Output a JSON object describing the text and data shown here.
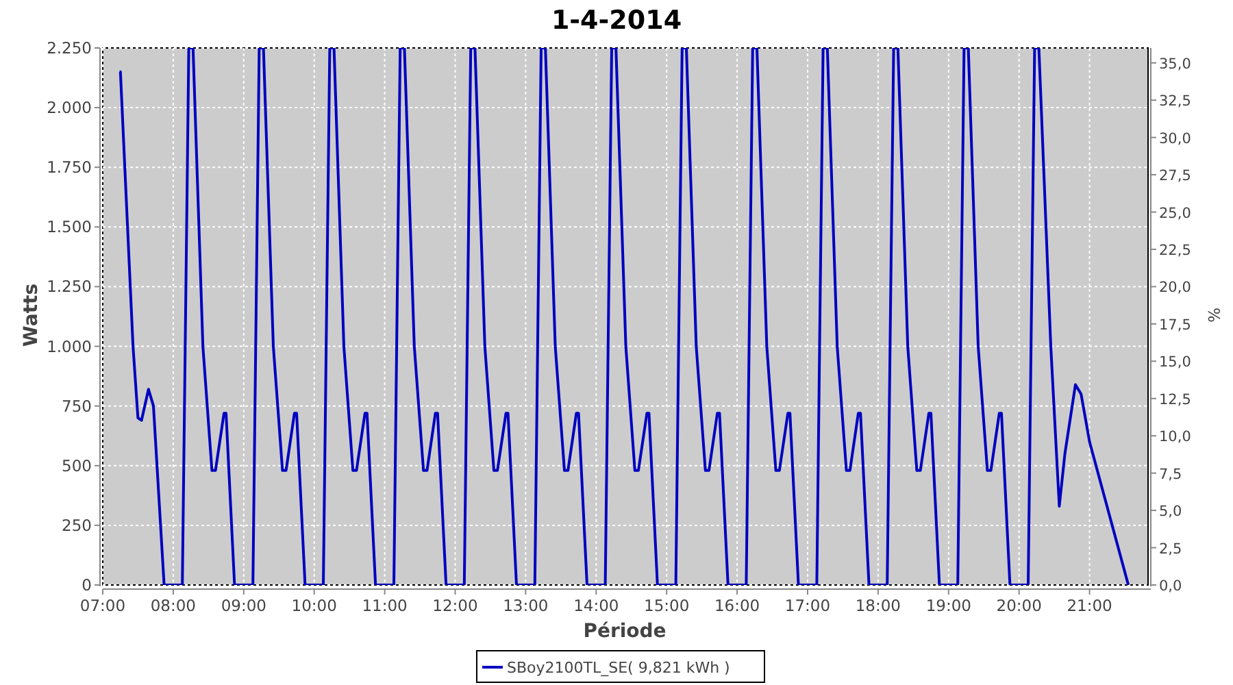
{
  "chart_data": {
    "type": "line",
    "title": "1-4-2014",
    "xlabel": "Période",
    "ylabel": "Watts",
    "y2label": "%",
    "grid": true,
    "xlim": [
      7,
      21.83
    ],
    "ylim": [
      0,
      2250
    ],
    "y2lim": [
      0,
      36
    ],
    "xticks": [
      {
        "value": 7,
        "label": "07:00"
      },
      {
        "value": 8,
        "label": "08:00"
      },
      {
        "value": 9,
        "label": "09:00"
      },
      {
        "value": 10,
        "label": "10:00"
      },
      {
        "value": 11,
        "label": "11:00"
      },
      {
        "value": 12,
        "label": "12:00"
      },
      {
        "value": 13,
        "label": "13:00"
      },
      {
        "value": 14,
        "label": "14:00"
      },
      {
        "value": 15,
        "label": "15:00"
      },
      {
        "value": 16,
        "label": "16:00"
      },
      {
        "value": 17,
        "label": "17:00"
      },
      {
        "value": 18,
        "label": "18:00"
      },
      {
        "value": 19,
        "label": "19:00"
      },
      {
        "value": 20,
        "label": "20:00"
      },
      {
        "value": 21,
        "label": "21:00"
      }
    ],
    "yticks": [
      {
        "value": 0,
        "label": "0"
      },
      {
        "value": 250,
        "label": "250"
      },
      {
        "value": 500,
        "label": "500"
      },
      {
        "value": 750,
        "label": "750"
      },
      {
        "value": 1000,
        "label": "1.000"
      },
      {
        "value": 1250,
        "label": "1.250"
      },
      {
        "value": 1500,
        "label": "1.500"
      },
      {
        "value": 1750,
        "label": "1.750"
      },
      {
        "value": 2000,
        "label": "2.000"
      },
      {
        "value": 2250,
        "label": "2.250"
      }
    ],
    "y2ticks": [
      {
        "value": 0,
        "label": "0,0"
      },
      {
        "value": 2.5,
        "label": "2,5"
      },
      {
        "value": 5,
        "label": "5,0"
      },
      {
        "value": 7.5,
        "label": "7,5"
      },
      {
        "value": 10,
        "label": "10,0"
      },
      {
        "value": 12.5,
        "label": "12,5"
      },
      {
        "value": 15,
        "label": "15,0"
      },
      {
        "value": 17.5,
        "label": "17,5"
      },
      {
        "value": 20,
        "label": "20,0"
      },
      {
        "value": 22.5,
        "label": "22,5"
      },
      {
        "value": 25,
        "label": "25,0"
      },
      {
        "value": 27.5,
        "label": "27,5"
      },
      {
        "value": 30,
        "label": "30,0"
      },
      {
        "value": 32.5,
        "label": "32,5"
      },
      {
        "value": 35,
        "label": "35,0"
      }
    ],
    "x": [
      7.24,
      7.25,
      7.43,
      7.5,
      7.55,
      7.65,
      7.72,
      7.87,
      8.13,
      8.22,
      8.28,
      8.42,
      8.55,
      8.6,
      8.72,
      8.75,
      8.87,
      9.13,
      9.22,
      9.28,
      9.42,
      9.55,
      9.6,
      9.72,
      9.75,
      9.87,
      10.13,
      10.22,
      10.28,
      10.42,
      10.55,
      10.6,
      10.72,
      10.75,
      10.87,
      11.13,
      11.22,
      11.28,
      11.42,
      11.55,
      11.6,
      11.72,
      11.75,
      11.87,
      12.13,
      12.22,
      12.28,
      12.42,
      12.55,
      12.6,
      12.72,
      12.75,
      12.87,
      13.13,
      13.22,
      13.28,
      13.42,
      13.55,
      13.6,
      13.72,
      13.75,
      13.87,
      14.13,
      14.22,
      14.28,
      14.42,
      14.55,
      14.6,
      14.72,
      14.75,
      14.87,
      15.13,
      15.22,
      15.28,
      15.42,
      15.55,
      15.6,
      15.72,
      15.75,
      15.87,
      16.13,
      16.22,
      16.28,
      16.42,
      16.55,
      16.6,
      16.72,
      16.75,
      16.87,
      17.13,
      17.22,
      17.28,
      17.42,
      17.55,
      17.6,
      17.72,
      17.75,
      17.87,
      18.13,
      18.22,
      18.28,
      18.42,
      18.55,
      18.6,
      18.72,
      18.75,
      18.87,
      19.13,
      19.22,
      19.28,
      19.42,
      19.55,
      19.6,
      19.72,
      19.75,
      19.87,
      20.13,
      20.22,
      20.28,
      20.45,
      20.57,
      20.65,
      20.8,
      20.88,
      21.0,
      21.55
    ],
    "series": [
      {
        "name": "SBoy2100TL_SE( 9,821 kWh )",
        "color": "#0000c0",
        "values": [
          2150,
          2150,
          1000,
          700,
          690,
          820,
          750,
          0,
          0,
          2250,
          2250,
          1000,
          480,
          480,
          720,
          720,
          0,
          0,
          2250,
          2250,
          1000,
          480,
          480,
          720,
          720,
          0,
          0,
          2250,
          2250,
          1000,
          480,
          480,
          720,
          720,
          0,
          0,
          2250,
          2250,
          1000,
          480,
          480,
          720,
          720,
          0,
          0,
          2250,
          2250,
          1000,
          480,
          480,
          720,
          720,
          0,
          0,
          2250,
          2250,
          1000,
          480,
          480,
          720,
          720,
          0,
          0,
          2250,
          2250,
          1000,
          480,
          480,
          720,
          720,
          0,
          0,
          2250,
          2250,
          1000,
          480,
          480,
          720,
          720,
          0,
          0,
          2250,
          2250,
          1000,
          480,
          480,
          720,
          720,
          0,
          0,
          2250,
          2250,
          1000,
          480,
          480,
          720,
          720,
          0,
          0,
          2250,
          2250,
          1000,
          480,
          480,
          720,
          720,
          0,
          0,
          2250,
          2250,
          1000,
          480,
          480,
          720,
          720,
          0,
          0,
          2250,
          2250,
          1000,
          330,
          550,
          840,
          800,
          600,
          0
        ]
      }
    ]
  }
}
